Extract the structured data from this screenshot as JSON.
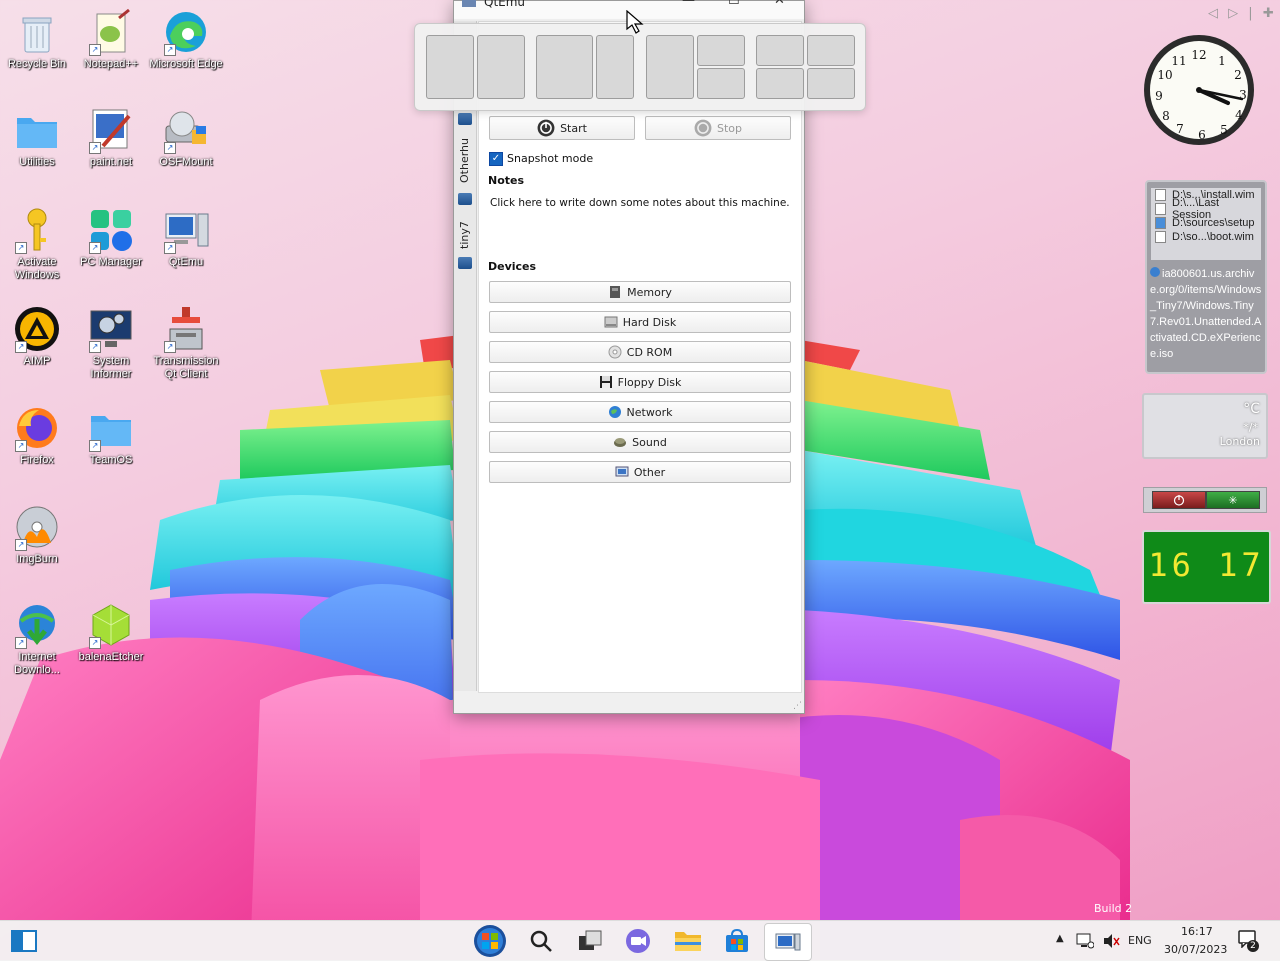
{
  "desktop_icons": [
    {
      "label": "Recycle Bin",
      "icon": "recycle-bin-icon"
    },
    {
      "label": "Notepad++",
      "icon": "notepad-plus-plus-icon"
    },
    {
      "label": "Microsoft Edge",
      "icon": "edge-icon"
    },
    {
      "label": "Utilities",
      "icon": "folder-icon"
    },
    {
      "label": "paint.net",
      "icon": "paintnet-icon"
    },
    {
      "label": "OSFMount",
      "icon": "osfmount-icon"
    },
    {
      "label": "Activate Windows",
      "icon": "key-icon"
    },
    {
      "label": "PC Manager",
      "icon": "pc-manager-icon"
    },
    {
      "label": "QtEmu",
      "icon": "qtemu-icon"
    },
    {
      "label": "AIMP",
      "icon": "aimp-icon"
    },
    {
      "label": "System Informer",
      "icon": "system-informer-icon"
    },
    {
      "label": "Transmission Qt Client",
      "icon": "transmission-icon"
    },
    {
      "label": "Firefox",
      "icon": "firefox-icon"
    },
    {
      "label": "TeamOS",
      "icon": "folder-icon"
    },
    {
      "label": "ImgBurn",
      "icon": "imgburn-icon"
    },
    {
      "label": "Internet Downlo...",
      "icon": "idm-icon"
    },
    {
      "label": "balenaEtcher",
      "icon": "balena-etcher-icon"
    }
  ],
  "window": {
    "title": "QtEmu",
    "side_tabs": [
      "Otherhu",
      "tiny7"
    ],
    "start_label": "Start",
    "stop_label": "Stop",
    "snapshot_label": "Snapshot mode",
    "notes_heading": "Notes",
    "notes_text": "Click here to write down some notes about this machine.",
    "devices_heading": "Devices",
    "devices": [
      "Memory",
      "Hard Disk",
      "CD ROM",
      "Floppy Disk",
      "Network",
      "Sound",
      "Other"
    ]
  },
  "gadgets": {
    "recent_files": [
      "D:\\s...\\install.wim",
      "D:\\...\\Last Session",
      "D:\\sources\\setup",
      "D:\\so...\\boot.wim"
    ],
    "recent_detail": "ia800601.us.archive.org/0/items/Windows_Tiny7/Windows.Tiny7.Rev01.Unattended.Activated.CD.eXPerience.iso",
    "weather_unit": "°C",
    "weather_value": "*/*",
    "weather_city": "London",
    "digital_time": "16 17"
  },
  "build_text": "Build 2",
  "taskbar": {
    "language": "ENG",
    "time": "16:17",
    "date": "30/07/2023",
    "notification_count": "2"
  }
}
